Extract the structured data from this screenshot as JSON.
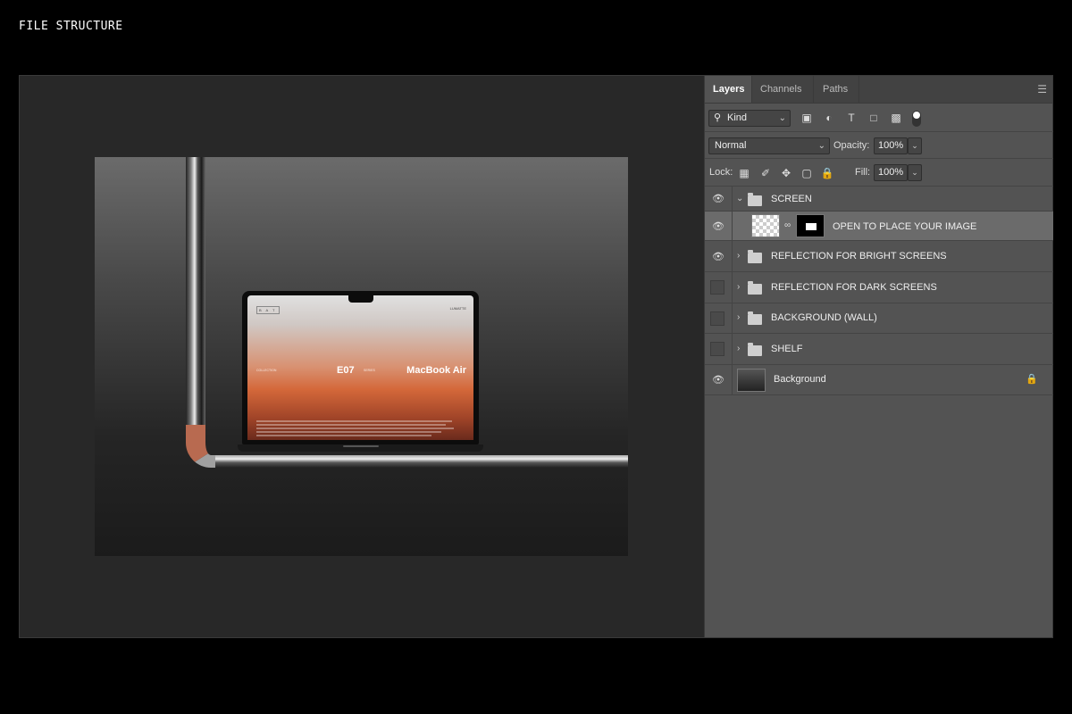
{
  "page": {
    "title": "FILE STRUCTURE"
  },
  "screen_content": {
    "logo": "B A T",
    "brand": "LUMATTE",
    "left_label": "COLLECTION",
    "code": "E07",
    "mid_label": "SERIES",
    "product": "MacBook Air"
  },
  "panel": {
    "tabs": [
      {
        "label": "Layers",
        "active": true
      },
      {
        "label": "Channels",
        "active": false
      },
      {
        "label": "Paths",
        "active": false
      }
    ],
    "filter": {
      "kind_label": "Kind"
    },
    "blend": {
      "mode": "Normal",
      "opacity_label": "Opacity:",
      "opacity": "100%"
    },
    "lock": {
      "label": "Lock:",
      "fill_label": "Fill:",
      "fill": "100%"
    },
    "layers": [
      {
        "name": "SCREEN",
        "type": "group",
        "visible": true,
        "expanded": true
      },
      {
        "name": "OPEN TO PLACE YOUR IMAGE",
        "type": "smart",
        "visible": true,
        "selected": true
      },
      {
        "name": "REFLECTION FOR BRIGHT SCREENS",
        "type": "group",
        "visible": true
      },
      {
        "name": "REFLECTION FOR DARK SCREENS",
        "type": "group",
        "visible": false
      },
      {
        "name": "BACKGROUND (WALL)",
        "type": "group",
        "visible": false
      },
      {
        "name": "SHELF",
        "type": "group",
        "visible": false
      },
      {
        "name": "Background",
        "type": "background",
        "visible": true,
        "locked": true
      }
    ]
  }
}
